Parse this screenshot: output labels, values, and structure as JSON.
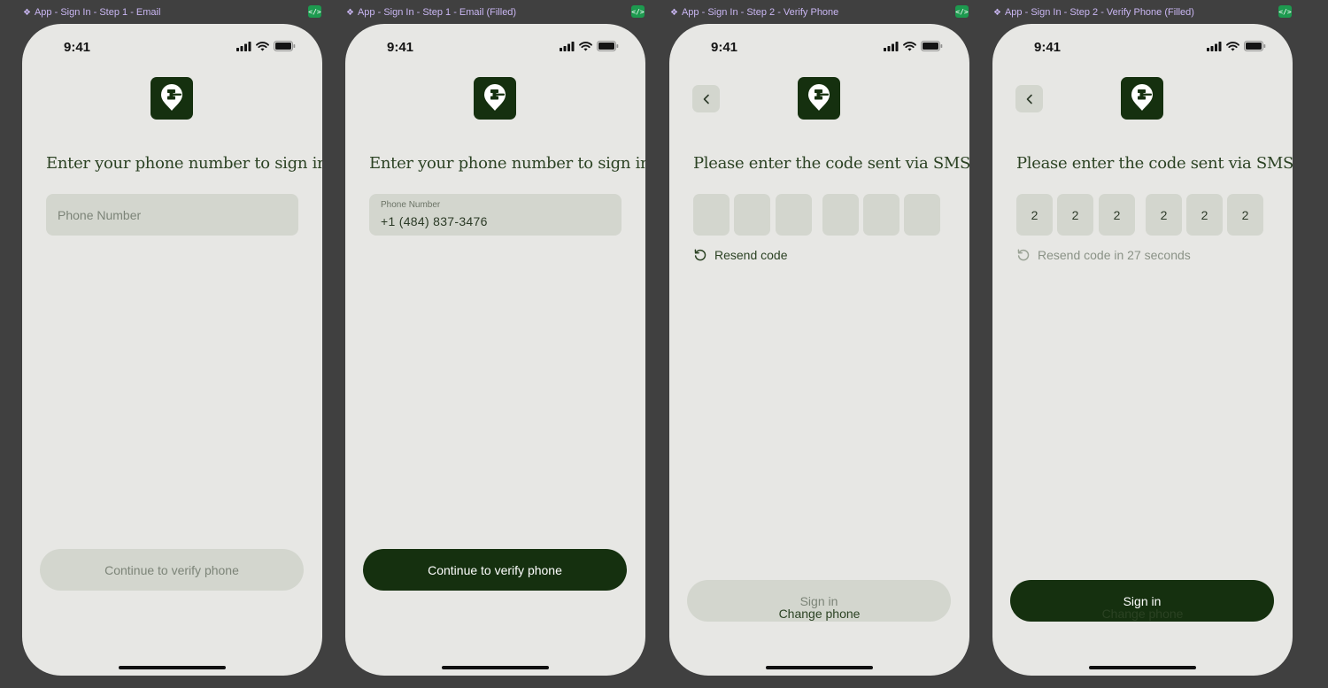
{
  "frames": [
    {
      "label": "App - Sign In - Step 1 - Email",
      "time": "9:41",
      "heading": "Enter your phone number to sign in",
      "input_placeholder": "Phone Number",
      "button_label": "Continue to verify phone",
      "button_state": "disabled"
    },
    {
      "label": "App - Sign In - Step 1 - Email (Filled)",
      "time": "9:41",
      "heading": "Enter your phone number to sign in",
      "input_label": "Phone Number",
      "input_value": "+1 (484) 837-3476",
      "button_label": "Continue to verify phone",
      "button_state": "active"
    },
    {
      "label": "App - Sign In - Step 2 - Verify Phone",
      "time": "9:41",
      "heading": "Please enter the code sent via SMS",
      "code_digits": [
        "",
        "",
        "",
        "",
        "",
        ""
      ],
      "resend_label": "Resend code",
      "button_label": "Sign in",
      "button_state": "disabled",
      "change_phone_label": "Change phone"
    },
    {
      "label": "App - Sign In - Step 2 - Verify Phone (Filled)",
      "time": "9:41",
      "heading": "Please enter the code sent via SMS",
      "code_digits": [
        "2",
        "2",
        "2",
        "2",
        "2",
        "2"
      ],
      "resend_label": "Resend code in 27 seconds",
      "button_label": "Sign in",
      "button_state": "active",
      "change_phone_label": "Change phone"
    }
  ],
  "colors": {
    "canvas": "#404040",
    "screen": "#e7e7e4",
    "brand": "#15300f",
    "field": "#d3d6ce",
    "heading_text": "#2b4223",
    "frame_label": "#c9b6f2",
    "code_badge": "#1d9a4f"
  },
  "icons": {
    "frame_label": "component-diamond-icon",
    "code_badge": "code-icon",
    "logo": "gavel-location-pin-icon",
    "back": "chevron-left-icon",
    "resend": "refresh-icon",
    "signal": "cellular-signal-icon",
    "wifi": "wifi-icon",
    "battery": "battery-icon"
  }
}
